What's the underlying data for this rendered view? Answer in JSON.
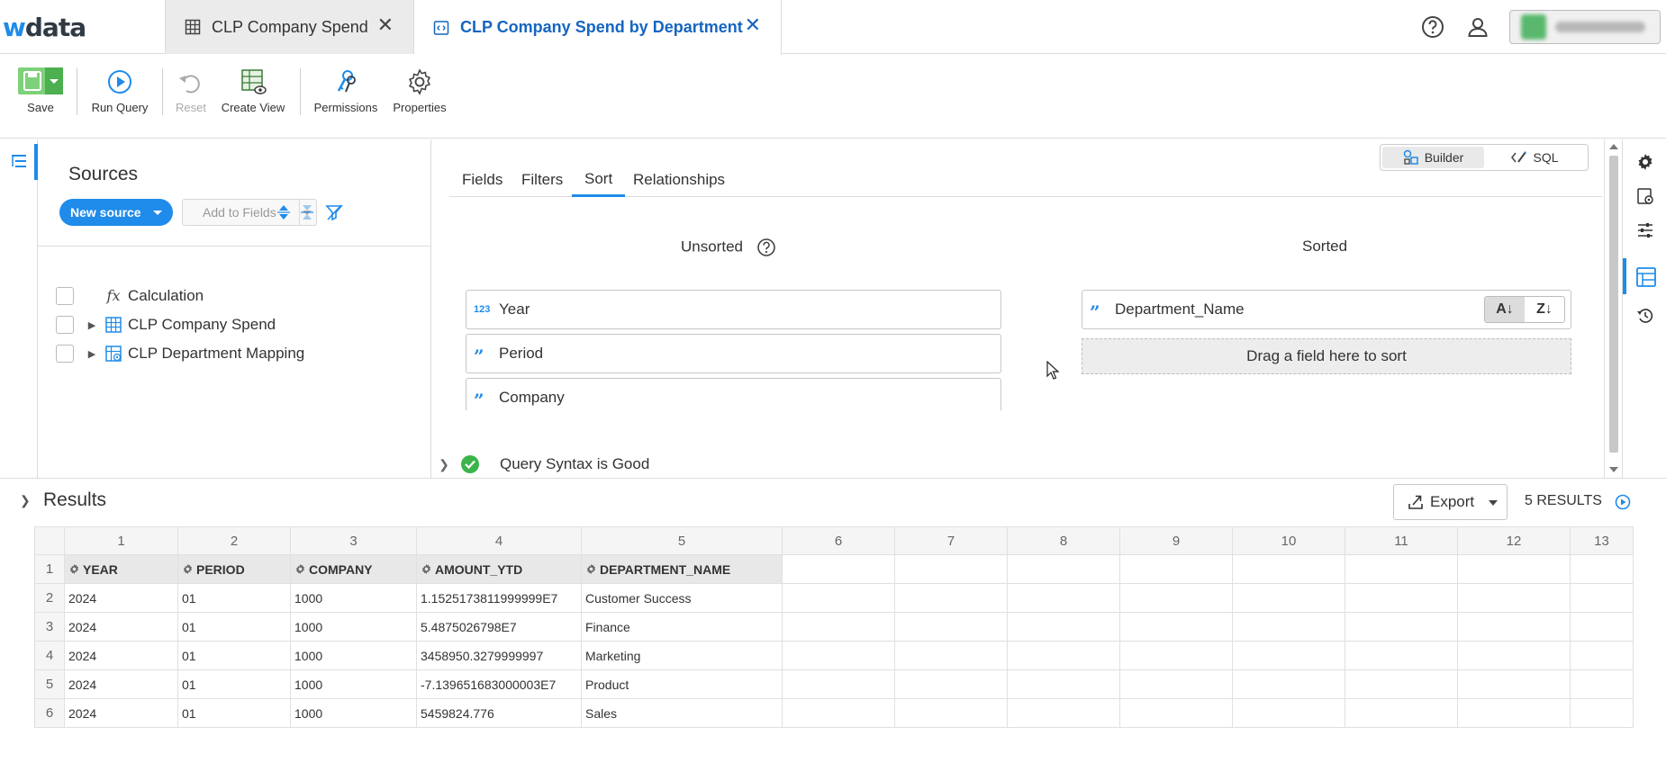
{
  "app": {
    "logo_w": "w",
    "logo_rest": "data"
  },
  "tabs": [
    {
      "label": "CLP Company Spend",
      "close": "✕"
    },
    {
      "label": "CLP Company Spend by Department",
      "close": "✕"
    }
  ],
  "toolbar": {
    "save": "Save",
    "run_query": "Run Query",
    "reset": "Reset",
    "create_view": "Create View",
    "permissions": "Permissions",
    "properties": "Properties"
  },
  "sources": {
    "title": "Sources",
    "new_source": "New source",
    "add_to_fields": "Add to Fields",
    "items": [
      {
        "label": "Calculation",
        "icon": "function-icon",
        "expandable": false
      },
      {
        "label": "CLP Company Spend",
        "icon": "table-icon",
        "expandable": true
      },
      {
        "label": "CLP Department Mapping",
        "icon": "view-table-icon",
        "expandable": true
      }
    ]
  },
  "builder": {
    "mode_builder": "Builder",
    "mode_sql": "SQL",
    "tabs": [
      "Fields",
      "Filters",
      "Sort",
      "Relationships"
    ],
    "active_tab": "Sort",
    "unsorted_title": "Unsorted",
    "sorted_title": "Sorted",
    "unsorted_fields": [
      {
        "name": "Year",
        "type": "123"
      },
      {
        "name": "Period",
        "type": "text"
      },
      {
        "name": "Company",
        "type": "text"
      }
    ],
    "sorted_fields": [
      {
        "name": "Department_Name",
        "type": "text",
        "asc": "A↓",
        "desc": "Z↓"
      }
    ],
    "drop_hint": "Drag a field here to sort",
    "status": "Query Syntax is Good"
  },
  "results": {
    "title": "Results",
    "export": "Export",
    "count": "5 RESULTS",
    "col_numbers": [
      "1",
      "2",
      "3",
      "4",
      "5",
      "6",
      "7",
      "8",
      "9",
      "10",
      "11",
      "12",
      "13"
    ],
    "headers": [
      "YEAR",
      "PERIOD",
      "COMPANY",
      "AMOUNT_YTD",
      "DEPARTMENT_NAME"
    ],
    "rows": [
      [
        "2024",
        "01",
        "1000",
        "1.1525173811999999E7",
        "Customer Success"
      ],
      [
        "2024",
        "01",
        "1000",
        "5.4875026798E7",
        "Finance"
      ],
      [
        "2024",
        "01",
        "1000",
        "3458950.3279999997",
        "Marketing"
      ],
      [
        "2024",
        "01",
        "1000",
        "-7.139651683000003E7",
        "Product"
      ],
      [
        "2024",
        "01",
        "1000",
        "5459824.776",
        "Sales"
      ]
    ],
    "row_numbers": [
      "1",
      "2",
      "3",
      "4",
      "5",
      "6"
    ]
  },
  "colors": {
    "accent": "#1f8bea",
    "active_tab_text": "#1565c0",
    "success": "#3cb44b"
  }
}
